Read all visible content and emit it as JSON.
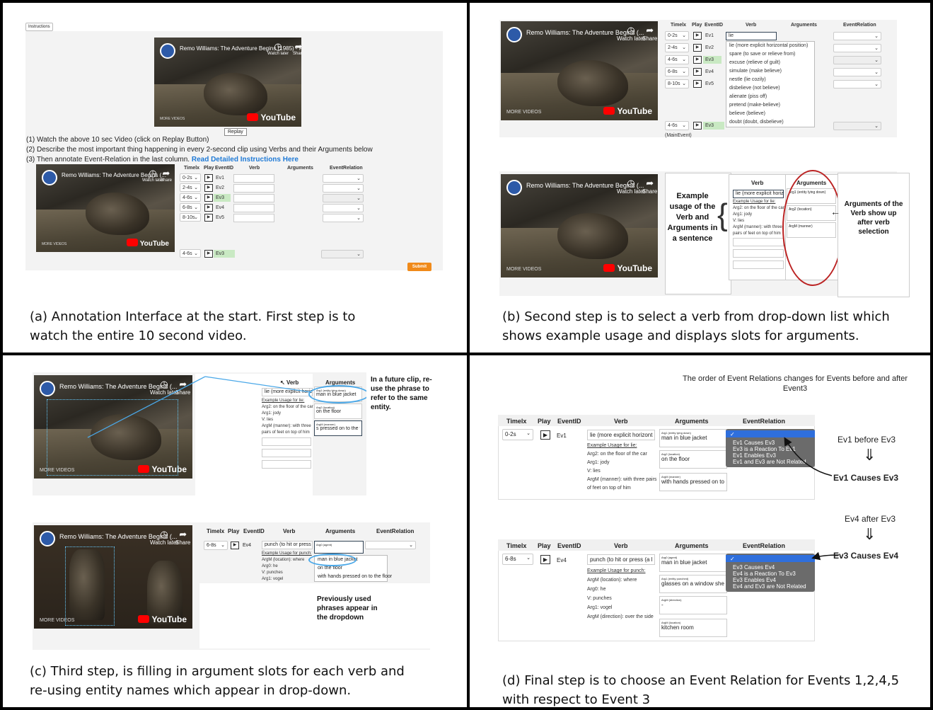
{
  "panel_a": {
    "instructions_label": "Instructions",
    "video_title": "Remo Williams: The Adventure Begins (1985) - Fi...",
    "video_title_short": "Remo Williams: The Adventure Begins (...",
    "watch_later": "Watch later",
    "share": "Share",
    "more_videos": "MORE VIDEOS",
    "youtube": "YouTube",
    "replay": "Replay",
    "step1": "(1) Watch the above 10 sec Video (click on Replay Button)",
    "step2": "(2) Describe the most important thing happening in every 2-second clip using Verbs and their Arguments below",
    "step3": "(3) Then annotate Event-Relation in the last column.",
    "step3_link": "Read Detailed Instructions Here",
    "headers": {
      "timex": "Timelx",
      "play": "Play",
      "eventid": "EventID",
      "verb": "Verb",
      "arguments": "Arguments",
      "eventrelation": "EventRelation"
    },
    "rows": [
      {
        "time": "0-2s",
        "ev": "Ev1"
      },
      {
        "time": "2-4s",
        "ev": "Ev2"
      },
      {
        "time": "4-6s",
        "ev": "Ev3"
      },
      {
        "time": "6-8s",
        "ev": "Ev4"
      },
      {
        "time": "8-10s",
        "ev": "Ev5"
      }
    ],
    "main_row": {
      "time": "4-6s",
      "ev": "Ev3"
    },
    "submit": "Submit",
    "caption": "(a) Annotation Interface at the start. First step is to\nwatch the entire 10 second video."
  },
  "panel_b": {
    "typed": "lie",
    "suggestions": [
      "lie (more explicit horizontal position)",
      "spare (to save or relieve from)",
      "excuse (relieve of guilt)",
      "simulate (make believe)",
      "nestle (lie cozily)",
      "disbelieve (not believe)",
      "alienate (piss off)",
      "pretend (make-believe)",
      "believe (believe)",
      "doubt (doubt, disbelieve)"
    ],
    "main_event_label": "(MainEvent)",
    "selected_verb": "lie (more explicit horizon",
    "example_heading": "Example Usage for lie:",
    "example_lines": [
      "Arg2: on the floor of the car",
      "Arg1: jody",
      "V: lies",
      "ArgM (manner): with three pairs of feet on top of him"
    ],
    "arg_slots": [
      "Arg1 (entity lying down)",
      "Arg2 (location)",
      "ArgM (manner)"
    ],
    "callout_left": "Example usage of the Verb and Arguments in a sentence",
    "callout_right": "Arguments of the Verb show up after verb selection",
    "caption": "(b) Second step is to select a verb from drop-down list which\nshows example usage and displays slots for arguments."
  },
  "panel_c": {
    "arg1_label": "Arg1 (entity lying down)",
    "arg1_value": "man in blue jacket",
    "arg2_label": "Arg2 (location)",
    "arg2_value": "on the floor",
    "argm_label": "ArgM (manner)",
    "argm_value": "s pressed on to the floor",
    "callout_top": "In a future clip, re-use the phrase to refer to the same entity.",
    "row_time": "6-8s",
    "row_ev": "Ev4",
    "verb_punch": "punch (to hit or press (a l",
    "punch_example_heading": "Example Usage for punch:",
    "punch_lines": [
      "ArgM (location): where",
      "Arg0: he",
      "V: punches",
      "Arg1: vogel"
    ],
    "argagent_label": "Arg0 (agent)",
    "previous_phrases": [
      "man in blue jacket",
      "on the floor",
      "with hands pressed on to the floor"
    ],
    "callout_bottom": "Previously used phrases appear in the dropdown",
    "caption": "(c) Third step, is filling in argument slots for each verb and\nre-using entity names which appear in drop-down."
  },
  "panel_d": {
    "note": "The order of Event Relations changes for Events before and after Event3",
    "row1": {
      "time": "0-2s",
      "ev": "Ev1",
      "verb": "lie (more explicit horizont"
    },
    "example1_heading": "Example Usage for lie:",
    "example1_lines": [
      "Arg2: on the floor of the car",
      "Arg1: jody",
      "V: lies",
      "ArgM (manner): with three pairs",
      "of feet on top of him"
    ],
    "args1": [
      {
        "label": "Arg1 (entity lying down)",
        "value": "man in blue jacket"
      },
      {
        "label": "Arg2 (location)",
        "value": "on the floor"
      },
      {
        "label": "ArgM (manner)",
        "value": "with hands pressed on to"
      }
    ],
    "options1": [
      "Ev1 Causes Ev3",
      "Ev3 is a Reaction To Ev1",
      "Ev1 Enables Ev3",
      "Ev1 and Ev3 are Not Related"
    ],
    "label1_top": "Ev1 before Ev3",
    "label1_bottom": "Ev1 Causes Ev3",
    "row2": {
      "time": "6-8s",
      "ev": "Ev4",
      "verb": "punch (to hit or press (a l"
    },
    "example2_heading": "Example Usage for punch:",
    "example2_lines": [
      "ArgM (location): where",
      "Arg0: he",
      "V: punches",
      "Arg1: vogel",
      "ArgM (direction): over the side"
    ],
    "args2": [
      {
        "label": "Arg0 (agent)",
        "value": "man in blue jacket"
      },
      {
        "label": "Arg1 (entity punched)",
        "value": "glasses on a window she"
      },
      {
        "label": "ArgM (direction)",
        "value": "-"
      },
      {
        "label": "ArgM (location)",
        "value": "kitchen room"
      }
    ],
    "options2": [
      "Ev3 Causes Ev4",
      "Ev4 is a Reaction To Ev3",
      "Ev3 Enables Ev4",
      "Ev4 and Ev3 are Not Related"
    ],
    "label2_top": "Ev4 after Ev3",
    "label2_bottom": "Ev3 Causes Ev4",
    "arrow": "⇓",
    "checkmark": "✓",
    "caption": "(d) Final step is to choose an Event Relation for Events 1,2,4,5\nwith respect to Event 3"
  }
}
